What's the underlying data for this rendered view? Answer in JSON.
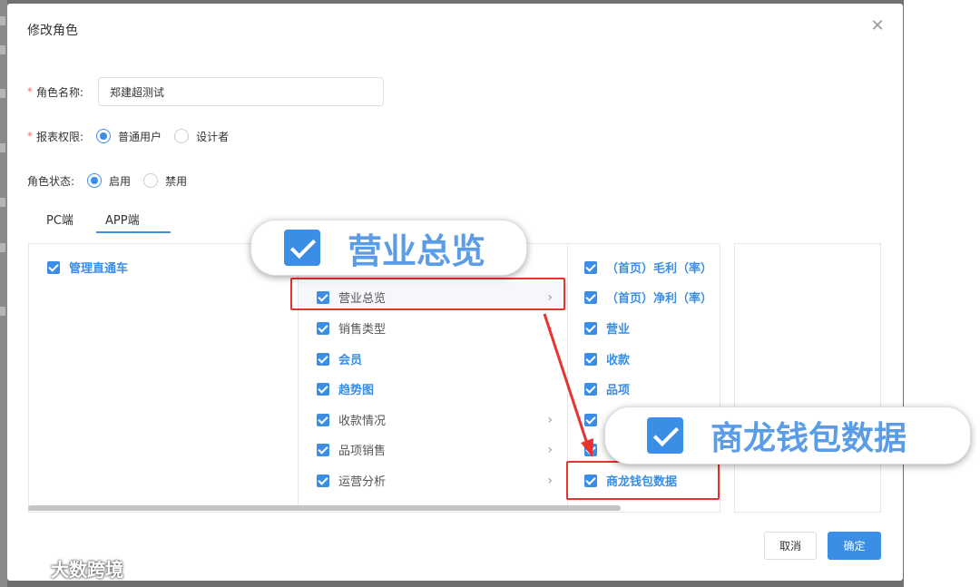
{
  "dialog": {
    "title": "修改角色",
    "close_icon": "close-icon"
  },
  "form": {
    "role_name": {
      "label": "角色名称:",
      "value": "郑建超测试"
    },
    "report_permission": {
      "label": "报表权限:",
      "options": [
        {
          "label": "普通用户",
          "selected": true
        },
        {
          "label": "设计者",
          "selected": false
        }
      ]
    },
    "role_status": {
      "label": "角色状态:",
      "options": [
        {
          "label": "启用",
          "selected": true
        },
        {
          "label": "禁用",
          "selected": false
        }
      ]
    }
  },
  "tabs": [
    {
      "label": "PC端",
      "active": false
    },
    {
      "label": "APP端",
      "active": true
    }
  ],
  "cascader": {
    "column1": [
      {
        "label": "管理直通车",
        "checked": true
      }
    ],
    "column2": [
      {
        "label": "营业总览",
        "checked": true,
        "has_children": true,
        "active": true
      },
      {
        "label": "销售类型",
        "checked": true,
        "has_children": true
      },
      {
        "label": "会员",
        "checked": true,
        "has_children": false
      },
      {
        "label": "趋势图",
        "checked": true,
        "has_children": false
      },
      {
        "label": "收款情况",
        "checked": true,
        "has_children": true
      },
      {
        "label": "品项销售",
        "checked": true,
        "has_children": true
      },
      {
        "label": "运营分析",
        "checked": true,
        "has_children": true
      }
    ],
    "column3": [
      {
        "label": "（首页）毛利（率）",
        "checked": true
      },
      {
        "label": "（首页）净利（率）",
        "checked": true
      },
      {
        "label": "营业",
        "checked": true
      },
      {
        "label": "收款",
        "checked": true
      },
      {
        "label": "品项",
        "checked": true
      },
      {
        "label": "",
        "checked": true
      },
      {
        "label": "",
        "checked": true
      },
      {
        "label": "商龙钱包数据",
        "checked": true
      }
    ]
  },
  "buttons": {
    "cancel": "取消",
    "ok": "确定"
  },
  "callouts": {
    "first": "营业总览",
    "second": "商龙钱包数据"
  },
  "watermark": "大数跨境",
  "colors": {
    "accent": "#3a8ee6",
    "highlight": "#e8322e",
    "required": "#f56c6c"
  }
}
